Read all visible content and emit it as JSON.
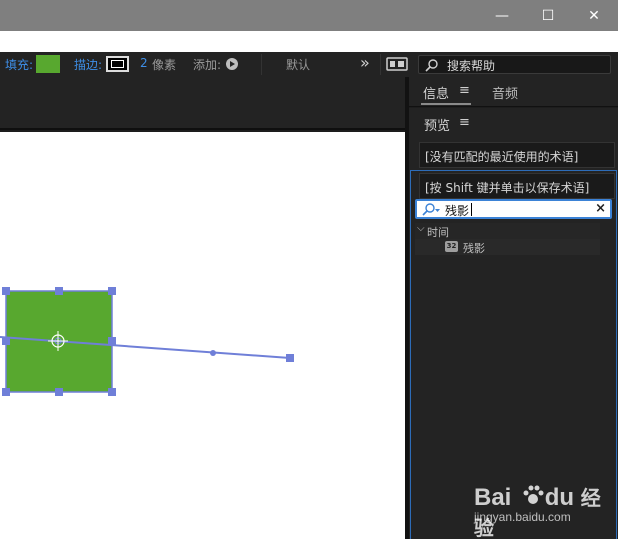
{
  "window": {
    "minimize_glyph": "—",
    "maximize_glyph": "☐",
    "close_glyph": "✕"
  },
  "toolbar": {
    "fill_label": "填充:",
    "fill_color": "#58a82f",
    "stroke_label": "描边:",
    "stroke_width_value": "2",
    "stroke_width_unit": "像素",
    "add_label": "添加:",
    "default_label": "默认",
    "overflow_glyph": "»",
    "search_help_placeholder": "搜索帮助"
  },
  "right_panel": {
    "tabs": [
      {
        "label": "信息"
      },
      {
        "label": "音频"
      }
    ],
    "preview_tab": "预览",
    "menu_glyph": "≡",
    "search_history": [
      "[没有匹配的最近使用的术语]",
      "[按 Shift 键并单击以保存术语]"
    ],
    "effects_search": {
      "value": "残影"
    },
    "results": {
      "category": "时间",
      "item": "残影"
    }
  },
  "colors": {
    "accent_blue": "#3e8ee6",
    "shape_fill": "#58a82f",
    "handle_color": "#6f7fd8"
  },
  "watermark": {
    "logo_text": "Bai du 经验",
    "url": "jingyan.baidu.com"
  }
}
